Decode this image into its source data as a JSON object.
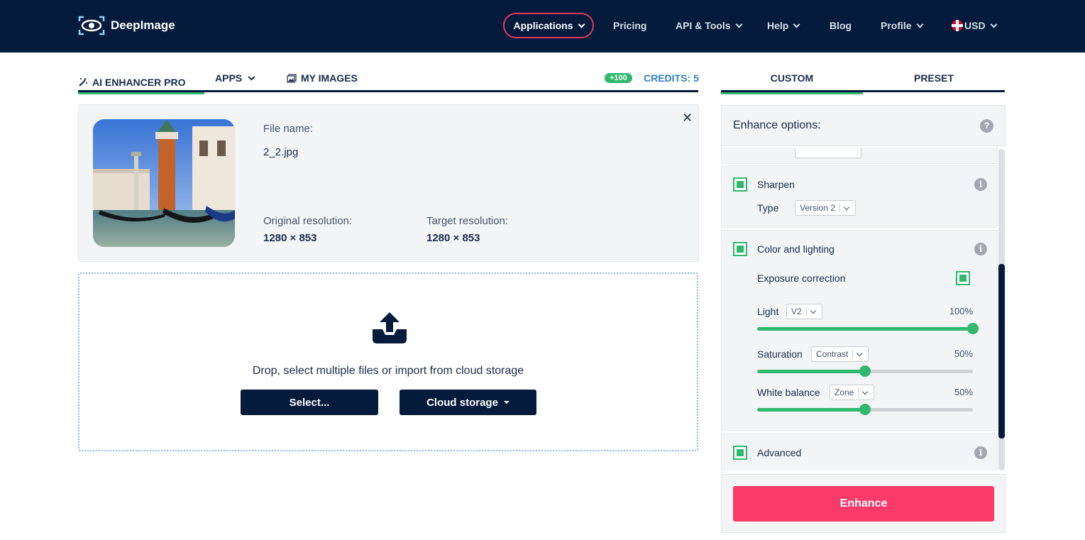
{
  "brand": {
    "name": "DeepImage"
  },
  "nav": {
    "applications": "Applications",
    "pricing": "Pricing",
    "api_tools": "API & Tools",
    "help": "Help",
    "blog": "Blog",
    "profile": "Profile",
    "currency": "USD"
  },
  "tabs": {
    "enhancer": "AI ENHANCER PRO",
    "apps": "APPS",
    "my_images": "MY IMAGES",
    "bonus": "+100",
    "credits": "CREDITS: 5"
  },
  "file": {
    "name_label": "File name:",
    "name": "2_2.jpg",
    "orig_label": "Original resolution:",
    "orig_value": "1280 × 853",
    "target_label": "Target resolution:",
    "target_value": "1280 × 853",
    "close": "✕"
  },
  "dropzone": {
    "text": "Drop, select multiple files or import from cloud storage",
    "select_label": "Select...",
    "cloud_label": "Cloud storage"
  },
  "right_tabs": {
    "custom": "CUSTOM",
    "preset": "PRESET"
  },
  "options": {
    "header": "Enhance options:",
    "help": "?",
    "info": "i",
    "sharpen": {
      "title": "Sharpen",
      "type_label": "Type",
      "type_value": "Version 2",
      "checked": true
    },
    "color": {
      "title": "Color and lighting",
      "exposure_label": "Exposure correction",
      "light_label": "Light",
      "light_mode": "V2",
      "light_pct": "100%",
      "light_value": 1.0,
      "saturation_label": "Saturation",
      "saturation_mode": "Contrast",
      "saturation_pct": "50%",
      "saturation_value": 0.5,
      "wb_label": "White balance",
      "wb_mode": "Zone",
      "wb_pct": "50%",
      "wb_value": 0.5
    },
    "advanced": {
      "title": "Advanced"
    }
  },
  "enhance_label": "Enhance",
  "colors": {
    "navy": "#041b3c",
    "green": "#2fb86e",
    "pink": "#fa3a6b",
    "blue_link": "#2f7fc6",
    "accent_border": "#e8365f"
  }
}
